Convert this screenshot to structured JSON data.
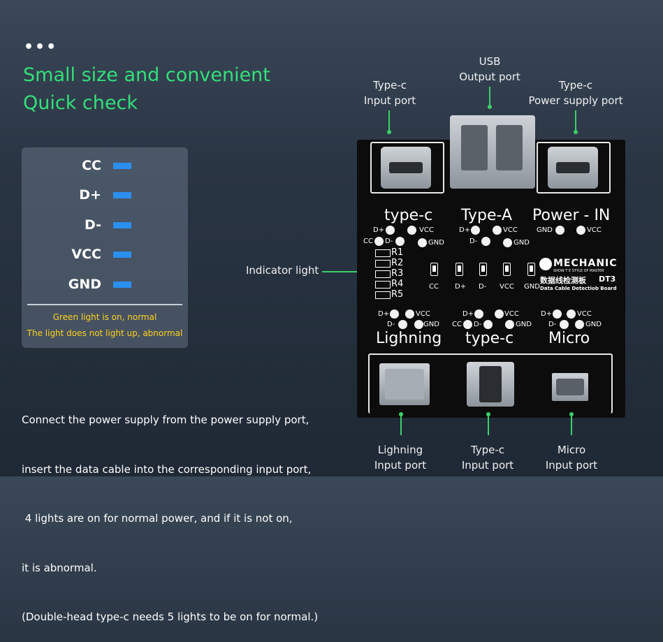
{
  "header": {
    "dots": "•••",
    "title_line1": "Small size and convenient",
    "title_line2": "Quick check"
  },
  "legend": {
    "items": [
      {
        "label": "CC",
        "color": "#2b8ff0"
      },
      {
        "label": "D+",
        "color": "#2b8ff0"
      },
      {
        "label": "D-",
        "color": "#2b8ff0"
      },
      {
        "label": "VCC",
        "color": "#2b8ff0"
      },
      {
        "label": "GND",
        "color": "#2b8ff0"
      }
    ],
    "note_normal": "Green light is on, normal",
    "note_abnormal": "The light does not light up, abnormal"
  },
  "description": {
    "line1": "Connect the power supply from the power supply port,",
    "line2": "insert the data cable into the corresponding input port,",
    "line3": " 4 lights are on for normal power, and if it is not on,",
    "line4": "it is abnormal.",
    "line5": "(Double-head type-c needs 5 lights to be on for normal.)"
  },
  "callouts": {
    "top_left": "Type-c\nInput port",
    "top_mid": "USB\nOutput port",
    "top_right": "Type-c\nPower supply port",
    "indicator": "Indicator light",
    "bot_left": "Lighning\nInput port",
    "bot_mid": "Type-c\nInput port",
    "bot_right": "Micro\nInput port"
  },
  "board": {
    "top_labels": {
      "typec": "type-c",
      "typea": "Type-A",
      "power": "Power - IN"
    },
    "bot_labels": {
      "lightning": "Lighning",
      "typec": "type-c",
      "micro": "Micro"
    },
    "pins": {
      "dplus": "D+",
      "dminus": "D-",
      "vcc": "VCC",
      "gnd": "GND",
      "cc": "CC"
    },
    "resistors": [
      "R1",
      "R2",
      "R3",
      "R4",
      "R5"
    ],
    "indicator_labels": [
      "CC",
      "D+",
      "D-",
      "VCC",
      "GND"
    ],
    "brand": "MECHANIC",
    "brand_tagline": "SHOW T E STYLE OF MASTER",
    "product_cn": "数据线检测板",
    "model": "DT3",
    "product_en": "Data Cable Detectiob Board"
  },
  "colors": {
    "accent_green": "#33e07a",
    "led_blue": "#2b8ff0",
    "note_yellow": "#ffd21e"
  }
}
